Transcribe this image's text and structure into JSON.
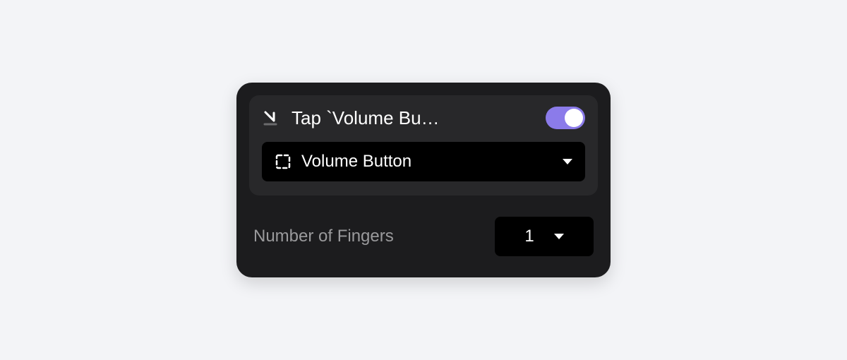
{
  "card": {
    "header": {
      "title": "Tap `Volume Bu…",
      "toggle_on": true
    },
    "element_selector": {
      "selected": "Volume Button"
    },
    "settings": {
      "fingers_label": "Number of Fingers",
      "fingers_value": "1"
    }
  },
  "colors": {
    "accent": "#8b7bea",
    "card_bg": "#1c1c1e",
    "section_bg": "#28282a",
    "dropdown_bg": "#000000",
    "page_bg": "#f3f4f7"
  }
}
